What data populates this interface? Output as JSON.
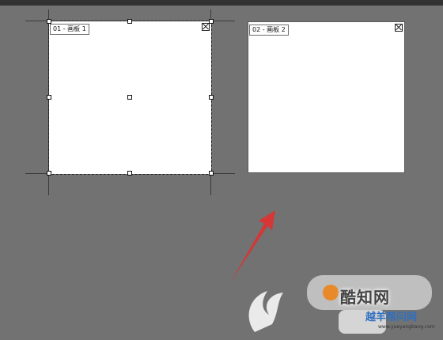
{
  "artboards": [
    {
      "label": "01 - 画板 1",
      "close_icon": "close-icon",
      "selected": true
    },
    {
      "label": "02 - 画板 2",
      "close_icon": "close-icon",
      "selected": false
    }
  ],
  "annotation": {
    "icon": "red-arrow-icon",
    "color": "#e03030"
  },
  "watermark": {
    "brand": "酷知网",
    "subtitle": "越羊帮问网",
    "url": "www.yueyangbang.com"
  },
  "colors": {
    "canvas": "#727272",
    "topbar": "#323232",
    "artboard": "#ffffff"
  }
}
